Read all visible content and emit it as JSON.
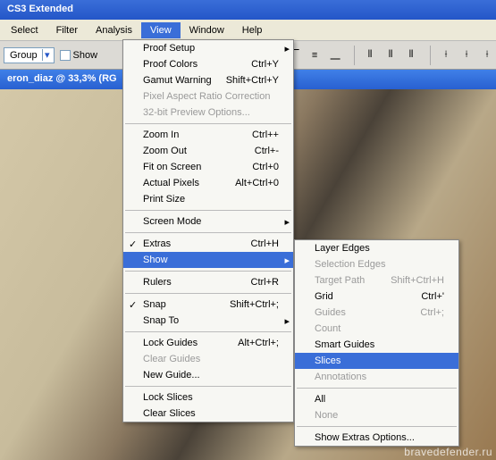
{
  "title": "CS3 Extended",
  "menubar": [
    "Select",
    "Filter",
    "Analysis",
    "View",
    "Window",
    "Help"
  ],
  "active_menu": "View",
  "options": {
    "combo_label": "Group",
    "show_label": "Show"
  },
  "doc_tab": "eron_diaz @ 33,3% (RG",
  "watermark": "bravedefender.ru",
  "view_menu": [
    {
      "label": "Proof Setup",
      "sub": true
    },
    {
      "label": "Proof Colors",
      "shortcut": "Ctrl+Y"
    },
    {
      "label": "Gamut Warning",
      "shortcut": "Shift+Ctrl+Y"
    },
    {
      "label": "Pixel Aspect Ratio Correction",
      "disabled": true
    },
    {
      "label": "32-bit Preview Options...",
      "disabled": true
    },
    {
      "sep": true
    },
    {
      "label": "Zoom In",
      "shortcut": "Ctrl++"
    },
    {
      "label": "Zoom Out",
      "shortcut": "Ctrl+-"
    },
    {
      "label": "Fit on Screen",
      "shortcut": "Ctrl+0"
    },
    {
      "label": "Actual Pixels",
      "shortcut": "Alt+Ctrl+0"
    },
    {
      "label": "Print Size"
    },
    {
      "sep": true
    },
    {
      "label": "Screen Mode",
      "sub": true
    },
    {
      "sep": true
    },
    {
      "label": "Extras",
      "shortcut": "Ctrl+H",
      "check": true
    },
    {
      "label": "Show",
      "sub": true,
      "hover": true
    },
    {
      "sep": true
    },
    {
      "label": "Rulers",
      "shortcut": "Ctrl+R"
    },
    {
      "sep": true
    },
    {
      "label": "Snap",
      "shortcut": "Shift+Ctrl+;",
      "check": true
    },
    {
      "label": "Snap To",
      "sub": true
    },
    {
      "sep": true
    },
    {
      "label": "Lock Guides",
      "shortcut": "Alt+Ctrl+;"
    },
    {
      "label": "Clear Guides",
      "disabled": true
    },
    {
      "label": "New Guide..."
    },
    {
      "sep": true
    },
    {
      "label": "Lock Slices"
    },
    {
      "label": "Clear Slices"
    }
  ],
  "show_menu": [
    {
      "label": "Layer Edges"
    },
    {
      "label": "Selection Edges",
      "disabled": true
    },
    {
      "label": "Target Path",
      "shortcut": "Shift+Ctrl+H",
      "disabled": true
    },
    {
      "label": "Grid",
      "shortcut": "Ctrl+'"
    },
    {
      "label": "Guides",
      "shortcut": "Ctrl+;",
      "disabled": true
    },
    {
      "label": "Count",
      "disabled": true
    },
    {
      "label": "Smart Guides"
    },
    {
      "label": "Slices",
      "hover": true
    },
    {
      "label": "Annotations",
      "disabled": true
    },
    {
      "sep": true
    },
    {
      "label": "All"
    },
    {
      "label": "None",
      "disabled": true
    },
    {
      "sep": true
    },
    {
      "label": "Show Extras Options..."
    }
  ]
}
